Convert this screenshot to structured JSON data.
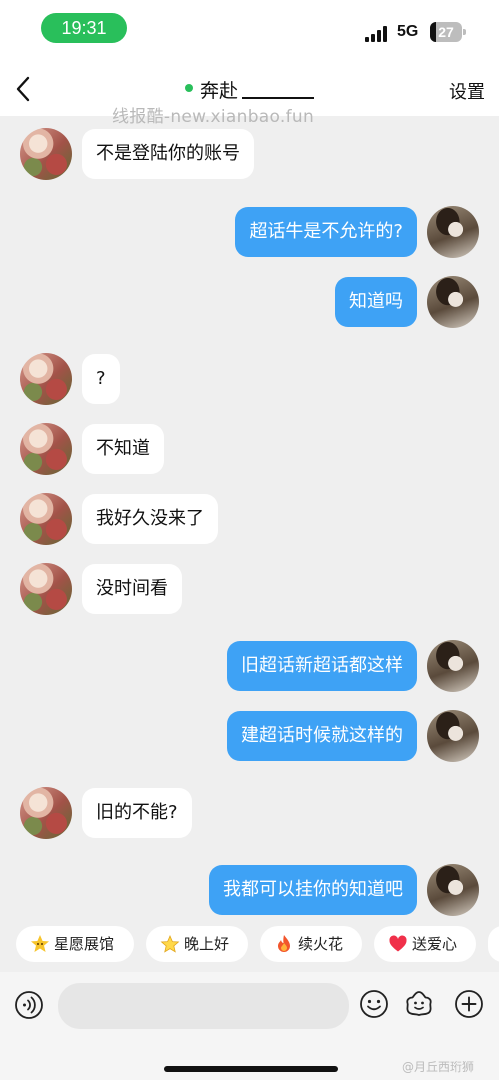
{
  "status_bar": {
    "time": "19:31",
    "network": "5G",
    "battery": "27"
  },
  "header": {
    "title": "奔赴",
    "settings_label": "设置"
  },
  "watermark": "线报酷-new.xianbao.fun",
  "messages": [
    {
      "side": "left",
      "text": "不是登陆你的账号"
    },
    {
      "side": "right",
      "text": "超话牛是不允许的?"
    },
    {
      "side": "right",
      "text": "知道吗"
    },
    {
      "side": "left",
      "text": "?"
    },
    {
      "side": "left",
      "text": "不知道"
    },
    {
      "side": "left",
      "text": "我好久没来了"
    },
    {
      "side": "left",
      "text": "没时间看"
    },
    {
      "side": "right",
      "text": "旧超话新超话都这样"
    },
    {
      "side": "right",
      "text": "建超话时候就这样的"
    },
    {
      "side": "left",
      "text": "旧的不能?"
    },
    {
      "side": "right",
      "text": "我都可以挂你的知道吧"
    }
  ],
  "quick_chips": [
    {
      "label": "星愿展馆",
      "icon": "star-face-icon"
    },
    {
      "label": "晚上好",
      "icon": "sparkle-star-icon"
    },
    {
      "label": "续火花",
      "icon": "fire-icon"
    },
    {
      "label": "送爱心",
      "icon": "heart-icon"
    }
  ],
  "input": {
    "placeholder": ""
  },
  "bottom_watermark": "@月丘西珩狮"
}
